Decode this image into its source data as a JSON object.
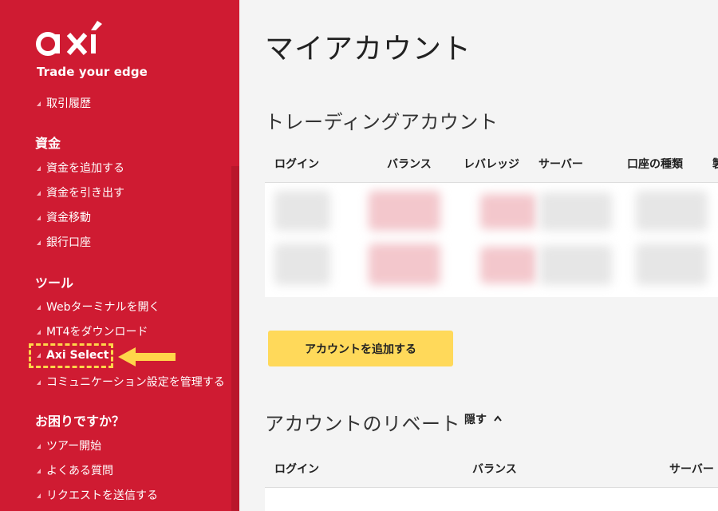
{
  "brand": {
    "logo": "axi",
    "tagline": "Trade your edge"
  },
  "sidebar": {
    "top_items": [
      {
        "label": "取引履歴"
      }
    ],
    "sections": [
      {
        "title": "資金",
        "items": [
          {
            "label": "資金を追加する"
          },
          {
            "label": "資金を引き出す"
          },
          {
            "label": "資金移動"
          },
          {
            "label": "銀行口座"
          }
        ]
      },
      {
        "title": "ツール",
        "items": [
          {
            "label": "Webターミナルを開く"
          },
          {
            "label": "MT4をダウンロード"
          },
          {
            "label": "Axi Select"
          },
          {
            "label": "コミュニケーション設定を管理する"
          }
        ]
      },
      {
        "title": "お困りですか？",
        "items": [
          {
            "label": "ツアー開始"
          },
          {
            "label": "よくある質問"
          },
          {
            "label": "リクエストを送信する"
          }
        ]
      }
    ]
  },
  "main": {
    "title": "マイアカウント",
    "trading": {
      "title": "トレーディングアカウント",
      "columns": [
        "ログイン",
        "バランス",
        "レバレッジ",
        "サーバー",
        "口座の種類",
        "製"
      ]
    },
    "add_button": "アカウントを追加する",
    "rebate": {
      "title": "アカウントのリベート",
      "toggle": "隠す",
      "columns": [
        "ログイン",
        "バランス",
        "サーバー"
      ]
    }
  },
  "colors": {
    "sidebar_bg": "#cf1b32",
    "button_bg": "#ffd95a",
    "highlight": "#ffd54a"
  }
}
